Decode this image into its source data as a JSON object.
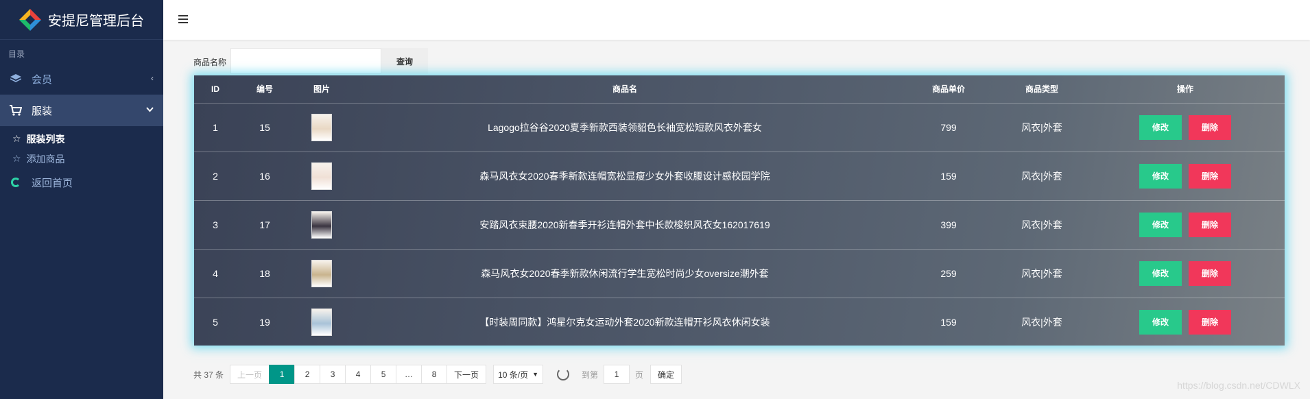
{
  "app": {
    "title": "安提尼管理后台",
    "logo_colors": [
      "#e8423c",
      "#2f8fd8",
      "#1ebc6a",
      "#f5b321"
    ]
  },
  "sidebar": {
    "section_label": "目录",
    "items": [
      {
        "label": "会员",
        "icon": "layers-icon",
        "chevron": "‹"
      },
      {
        "label": "服装",
        "icon": "cart-icon",
        "chevron": "⌄",
        "expanded": true
      }
    ],
    "subitems": [
      {
        "label": "服装列表",
        "current": true
      },
      {
        "label": "添加商品",
        "current": false
      }
    ],
    "home": {
      "label": "返回首页",
      "icon": "refresh-ring-icon"
    }
  },
  "search": {
    "label": "商品名称",
    "value": "",
    "placeholder": "",
    "button": "查询"
  },
  "table": {
    "headers": [
      "ID",
      "编号",
      "图片",
      "商品名",
      "商品单价",
      "商品类型",
      "操作"
    ],
    "rows": [
      {
        "id": "1",
        "code": "15",
        "name": "Lagogo拉谷谷2020夏季新款西装领貂色长袖宽松短款风衣外套女",
        "price": "799",
        "type": "风衣|外套",
        "thumb": "#e9d8c4"
      },
      {
        "id": "2",
        "code": "16",
        "name": "森马风衣女2020春季新款连帽宽松显瘦少女外套收腰设计感校园学院",
        "price": "159",
        "type": "风衣|外套",
        "thumb": "#f0e0d6"
      },
      {
        "id": "3",
        "code": "17",
        "name": "安踏风衣束腰2020新春季开衫连帽外套中长款梭织风衣女162017619",
        "price": "399",
        "type": "风衣|外套",
        "thumb": "#3a3440"
      },
      {
        "id": "4",
        "code": "18",
        "name": "森马风衣女2020春季新款休闲流行学生宽松时尚少女oversize潮外套",
        "price": "259",
        "type": "风衣|外套",
        "thumb": "#c9b48e"
      },
      {
        "id": "5",
        "code": "19",
        "name": "【时装周同款】鸿星尔克女运动外套2020新款连帽开衫风衣休闲女装",
        "price": "159",
        "type": "风衣|外套",
        "thumb": "#a9c3d8"
      }
    ],
    "edit_label": "修改",
    "delete_label": "删除"
  },
  "pagination": {
    "total": "共 37 条",
    "prev": "上一页",
    "pages": [
      "1",
      "2",
      "3",
      "4",
      "5",
      "…",
      "8"
    ],
    "current_page": "1",
    "next": "下一页",
    "page_size": "10 条/页",
    "goto_label": "到第",
    "goto_value": "1",
    "goto_unit": "页",
    "confirm": "确定"
  },
  "watermark": "https://blog.csdn.net/CDWLX"
}
